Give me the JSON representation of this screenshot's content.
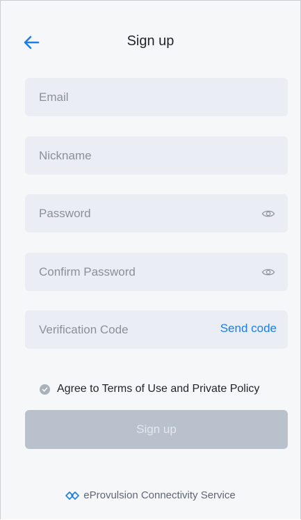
{
  "header": {
    "title": "Sign up",
    "back_icon": "arrow-left-icon"
  },
  "form": {
    "email_placeholder": "Email",
    "nickname_placeholder": "Nickname",
    "password_placeholder": "Password",
    "confirm_password_placeholder": "Confirm Password",
    "verification_placeholder": "Verification Code",
    "send_code_label": "Send code",
    "eye_icon": "eye-icon"
  },
  "agreement": {
    "text": "Agree to Terms of Use and Private Policy",
    "checked": true
  },
  "submit_label": "Sign up",
  "footer": {
    "text": "eProvulsion Connectivity Service",
    "logo_icon": "eprop-logo-icon"
  },
  "colors": {
    "accent": "#1c7ee6",
    "field_bg": "#eaedf3",
    "button_disabled": "#b9c1cc",
    "page_bg": "#f6f7f9"
  }
}
